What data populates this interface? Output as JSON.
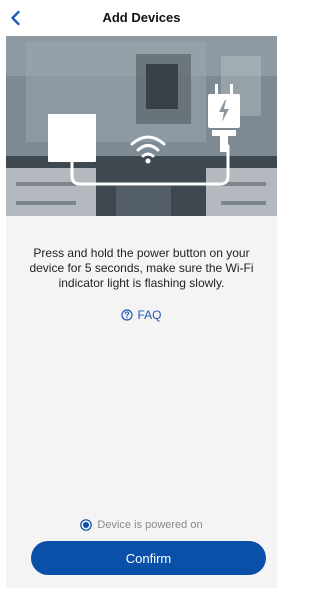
{
  "header": {
    "title": "Add Devices",
    "back_icon": "chevron-left-icon"
  },
  "hero": {
    "icons": [
      "plug-device-icon",
      "wifi-icon",
      "power-adapter-icon"
    ]
  },
  "instruction": {
    "text": "Press and hold the power button on your device for 5 seconds, make sure the Wi-Fi indicator light is flashing slowly."
  },
  "faq": {
    "label": "FAQ",
    "icon": "help-circle-icon"
  },
  "powered_check": {
    "label": "Device is powered on",
    "checked": true
  },
  "confirm": {
    "label": "Confirm"
  },
  "colors": {
    "accent": "#0a4fa8",
    "link": "#1f5ab6"
  }
}
